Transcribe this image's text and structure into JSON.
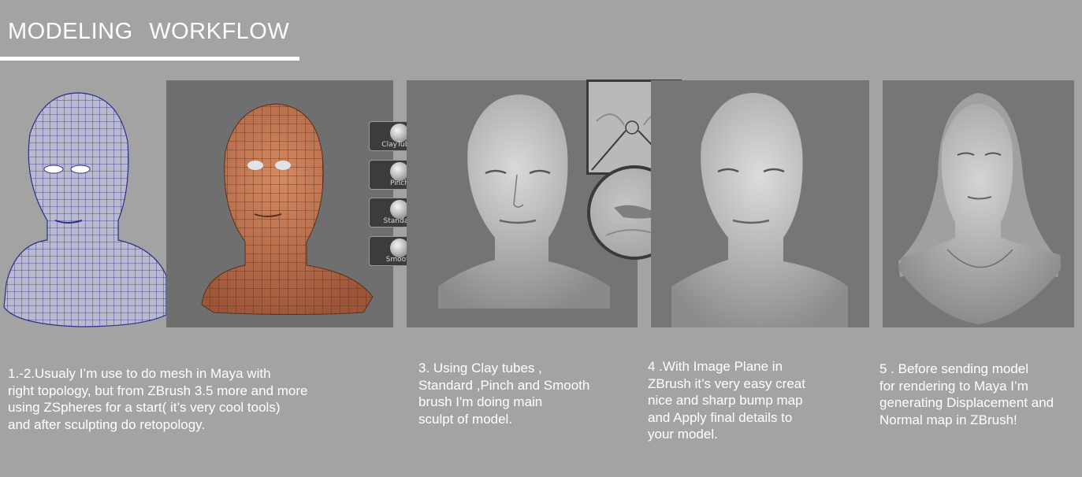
{
  "title": "MODELING   WORKFLOW",
  "brushes": [
    {
      "label": "ClayTubes"
    },
    {
      "label": "Pinch"
    },
    {
      "label": "Standard"
    },
    {
      "label": "Smooth"
    }
  ],
  "steps": [
    {
      "lines": [
        "1.-2.Usualy  I’m  use  to  do  mesh  in  Maya     with",
        "right  topology,    but  from  ZBrush  3.5  more  and  more",
        "using    ZSpheres  for  a  start(  it’s  very  cool  tools)",
        "and  after  sculpting  do  retopology."
      ]
    },
    {
      "lines": [
        "3.   Using     Clay  tubes  ,",
        "Standard  ,Pinch  and  Smooth",
        "brush     I'm  doing      main",
        "sculpt  of  model."
      ]
    },
    {
      "lines": [
        "4  .With  Image  Plane  in",
        "ZBrush  it’s     very  easy  creat",
        "nice  and  sharp  bump  map",
        "and  Apply  final  details  to",
        "your   model."
      ]
    },
    {
      "lines": [
        "5  .  Before  sending  model",
        "for  rendering  to  Maya  I’m",
        "generating  Displacement  and",
        "Normal  map  in  ZBrush!"
      ]
    }
  ],
  "colors": {
    "background": "#a3a3a3",
    "wireframe": "#2a2f8a",
    "sculpt_orange": "#c0704c",
    "panel": "#727272"
  }
}
